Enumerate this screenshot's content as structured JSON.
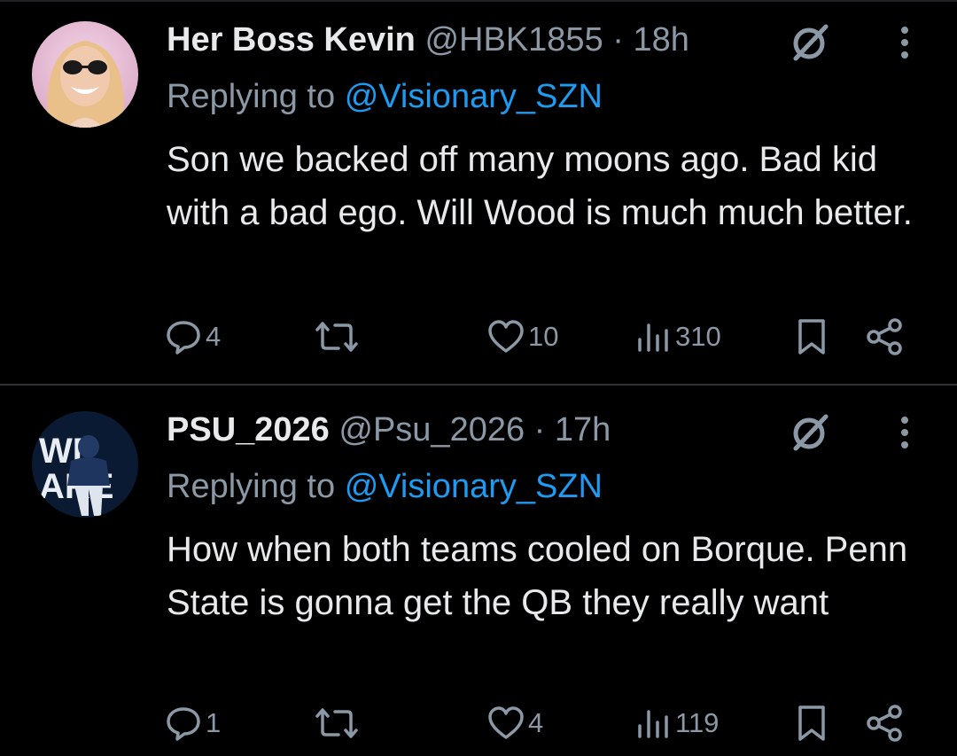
{
  "colors": {
    "background": "#000000",
    "primary_text": "#e7e9ea",
    "secondary_text": "#8b98a5",
    "mention": "#1d9bf0",
    "divider": "#2f3336"
  },
  "tweets": [
    {
      "name": "Her Boss Kevin",
      "handle": "@HBK1855",
      "separator": "·",
      "time": "18h",
      "replying_prefix": "Replying to",
      "replying_to": "@Visionary_SZN",
      "text": "Son we backed off many moons ago. Bad kid with a bad ego. Will Wood is much much better.",
      "actions": {
        "replies": "4",
        "reposts": "",
        "likes": "10",
        "views": "310"
      },
      "icons": [
        "grok-icon",
        "more-icon",
        "reply-icon",
        "repost-icon",
        "like-icon",
        "views-icon",
        "bookmark-icon",
        "share-icon"
      ]
    },
    {
      "name": "PSU_2026",
      "handle": "@Psu_2026",
      "separator": "·",
      "time": "17h",
      "replying_prefix": "Replying to",
      "replying_to": "@Visionary_SZN",
      "text": "How when both teams cooled on Borque. Penn State is gonna get the QB they really want",
      "actions": {
        "replies": "1",
        "reposts": "",
        "likes": "4",
        "views": "119"
      },
      "avatar_text": "WE ARE",
      "icons": [
        "grok-icon",
        "more-icon",
        "reply-icon",
        "repost-icon",
        "like-icon",
        "views-icon",
        "bookmark-icon",
        "share-icon"
      ]
    }
  ]
}
